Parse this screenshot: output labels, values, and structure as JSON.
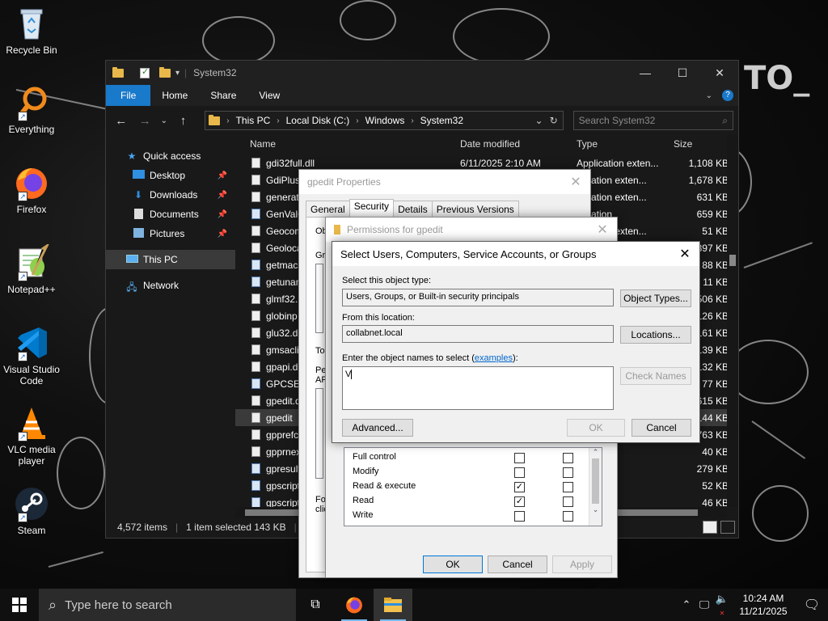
{
  "desktop": {
    "icons": [
      {
        "label": "Recycle Bin",
        "icon": "recycle-bin-icon"
      },
      {
        "label": "Everything",
        "icon": "everything-search-icon"
      },
      {
        "label": "Firefox",
        "icon": "firefox-icon"
      },
      {
        "label": "Notepad++",
        "icon": "notepad-plus-plus-icon"
      },
      {
        "label": "Visual Studio Code",
        "icon": "vscode-icon"
      },
      {
        "label": "VLC media player",
        "icon": "vlc-icon"
      },
      {
        "label": "Steam",
        "icon": "steam-icon"
      }
    ],
    "wallpaper_text": "TO_"
  },
  "explorer": {
    "title": "System32",
    "ribbon_tabs": [
      "File",
      "Home",
      "Share",
      "View"
    ],
    "breadcrumb": [
      "This PC",
      "Local Disk (C:)",
      "Windows",
      "System32"
    ],
    "search_placeholder": "Search System32",
    "nav": {
      "quick_access": "Quick access",
      "items": [
        "Desktop",
        "Downloads",
        "Documents",
        "Pictures"
      ],
      "this_pc": "This PC",
      "network": "Network"
    },
    "columns": {
      "name": "Name",
      "date": "Date modified",
      "type": "Type",
      "size": "Size"
    },
    "files": [
      {
        "name": "gdi32full.dll",
        "date": "6/11/2025 2:10 AM",
        "type": "Application exten...",
        "size": "1,108 KB"
      },
      {
        "name": "GdiPlus",
        "date": "",
        "type": "plication exten...",
        "size": "1,678 KB"
      },
      {
        "name": "generat",
        "date": "",
        "type": "plication exten...",
        "size": "631 KB"
      },
      {
        "name": "GenValC",
        "date": "",
        "type": "plication",
        "size": "659 KB"
      },
      {
        "name": "Geocom",
        "date": "",
        "type": "plication exten...",
        "size": "51 KB"
      },
      {
        "name": "Geoloca",
        "date": "",
        "type": "",
        "size": "397 KB"
      },
      {
        "name": "getmac",
        "date": "",
        "type": "",
        "size": "88 KB"
      },
      {
        "name": "getunan",
        "date": "",
        "type": "",
        "size": "11 KB"
      },
      {
        "name": "glmf32.",
        "date": "",
        "type": "",
        "size": "506 KB"
      },
      {
        "name": "globinp",
        "date": "",
        "type": "",
        "size": "126 KB"
      },
      {
        "name": "glu32.dl",
        "date": "",
        "type": "",
        "size": "161 KB"
      },
      {
        "name": "gmsacli",
        "date": "",
        "type": "",
        "size": "139 KB"
      },
      {
        "name": "gpapi.dl",
        "date": "",
        "type": "",
        "size": "132 KB"
      },
      {
        "name": "GPCSEW",
        "date": "",
        "type": "",
        "size": "77 KB"
      },
      {
        "name": "gpedit.d",
        "date": "",
        "type": "",
        "size": "615 KB"
      },
      {
        "name": "gpedit",
        "date": "",
        "type": "",
        "size": "144 KB"
      },
      {
        "name": "gpprefc",
        "date": "",
        "type": "",
        "size": "763 KB"
      },
      {
        "name": "gpprnex",
        "date": "",
        "type": "n exten...",
        "size": "40 KB"
      },
      {
        "name": "gpresult",
        "date": "",
        "type": "n",
        "size": "279 KB"
      },
      {
        "name": "gpscript",
        "date": "",
        "type": "n exten...",
        "size": "52 KB"
      },
      {
        "name": "gpscript",
        "date": "",
        "type": "n",
        "size": "46 KB"
      }
    ],
    "status": {
      "count": "4,572 items",
      "selection": "1 item selected  143 KB"
    }
  },
  "gpedit_props": {
    "title": "gpedit Properties",
    "tabs": [
      "General",
      "Security",
      "Details",
      "Previous Versions"
    ],
    "fragments": [
      "Ob",
      "Gro",
      "To",
      "Pe",
      "AP",
      "For",
      "clic"
    ],
    "buttons": {
      "ok": "OK",
      "cancel": "Cancel",
      "apply": "Apply"
    }
  },
  "permissions": {
    "title": "Permissions for gpedit",
    "rows": [
      {
        "label": "Full control",
        "allow": false,
        "deny": false
      },
      {
        "label": "Modify",
        "allow": false,
        "deny": false
      },
      {
        "label": "Read & execute",
        "allow": true,
        "deny": false
      },
      {
        "label": "Read",
        "allow": true,
        "deny": false
      },
      {
        "label": "Write",
        "allow": false,
        "deny": false
      }
    ]
  },
  "select_users": {
    "title": "Select Users, Computers, Service Accounts, or Groups",
    "object_type_label": "Select this object type:",
    "object_type_value": "Users, Groups, or Built-in security principals",
    "object_types_button": "Object Types...",
    "location_label": "From this location:",
    "location_value": "collabnet.local",
    "locations_button": "Locations...",
    "names_label_prefix": "Enter the object names to select (",
    "names_label_link": "examples",
    "names_label_suffix": "):",
    "names_value": "V",
    "check_names_button": "Check Names",
    "advanced_button": "Advanced...",
    "ok_button": "OK",
    "cancel_button": "Cancel"
  },
  "taskbar": {
    "search_placeholder": "Type here to search",
    "time": "10:24 AM",
    "date": "11/21/2025"
  }
}
